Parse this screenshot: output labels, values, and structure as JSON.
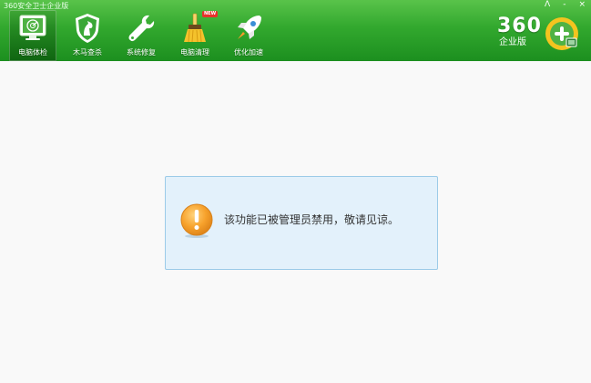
{
  "window": {
    "title": "360安全卫士企业版",
    "controls": [
      "ⴷ",
      "-",
      "×"
    ]
  },
  "toolbar": {
    "items": [
      {
        "label": "电脑体检",
        "icon": "computer-check-icon",
        "active": true
      },
      {
        "label": "木马查杀",
        "icon": "trojan-shield-icon",
        "active": false
      },
      {
        "label": "系统修复",
        "icon": "wrench-icon",
        "active": false
      },
      {
        "label": "电脑清理",
        "icon": "broom-icon",
        "active": false,
        "badge": "NEW"
      },
      {
        "label": "优化加速",
        "icon": "rocket-icon",
        "active": false
      }
    ]
  },
  "brand": {
    "number": "360",
    "edition": "企业版",
    "logo_icon": "360-logo-icon"
  },
  "notice": {
    "icon": "warning-icon",
    "message": "该功能已被管理员禁用，敬请见谅。"
  },
  "colors": {
    "header_green": "#32a82e",
    "dialog_bg": "#e3f1fb",
    "dialog_border": "#9ccbe8",
    "warning_orange": "#f39c24"
  }
}
